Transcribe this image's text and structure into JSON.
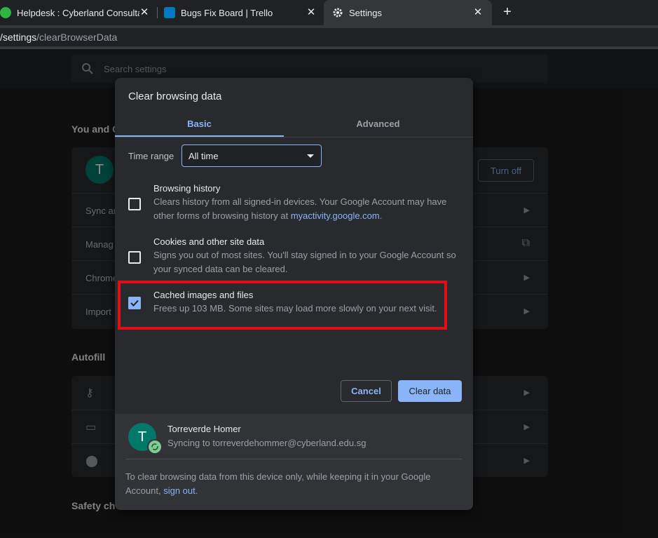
{
  "tabs": [
    {
      "title": "Helpdesk : Cyberland Consultanc",
      "favicon_color": "#2fb344"
    },
    {
      "title": "Bugs Fix Board | Trello",
      "favicon_color": "#0079bf"
    },
    {
      "title": "Settings",
      "icon": "gear-icon"
    }
  ],
  "address": {
    "url_strong": "/settings",
    "url_rest": "/clearBrowserData"
  },
  "settings_page": {
    "search_placeholder": "Search settings",
    "you_and_google": "You and G",
    "rows": [
      "Sync ar",
      "Manag",
      "Chrome",
      "Import"
    ],
    "turn_off": "Turn off",
    "autofill": "Autofill",
    "safety": "Safety ch",
    "avatar_letter": "T"
  },
  "dialog": {
    "title": "Clear browsing data",
    "tabs": {
      "basic": "Basic",
      "advanced": "Advanced"
    },
    "time_range": {
      "label": "Time range",
      "value": "All time"
    },
    "options": [
      {
        "title": "Browsing history",
        "desc_before": "Clears history from all signed-in devices. Your Google Account may have other forms of browsing history at ",
        "link": "myactivity.google.com",
        "desc_after": ".",
        "checked": false
      },
      {
        "title": "Cookies and other site data",
        "desc": "Signs you out of most sites. You'll stay signed in to your Google Account so your synced data can be cleared.",
        "checked": false
      },
      {
        "title": "Cached images and files",
        "desc": "Frees up 103 MB. Some sites may load more slowly on your next visit.",
        "checked": true
      }
    ],
    "cancel": "Cancel",
    "clear": "Clear data",
    "account": {
      "letter": "T",
      "name": "Torreverde Homer",
      "sync": "Syncing to torreverdehommer@cyberland.edu.sg"
    },
    "footer_note_before": "To clear browsing data from this device only, while keeping it in your Google Account, ",
    "footer_link": "sign out",
    "footer_note_after": "."
  },
  "colors": {
    "accent": "#8ab4f8",
    "highlight": "#e30d18",
    "avatar": "#00796b"
  }
}
